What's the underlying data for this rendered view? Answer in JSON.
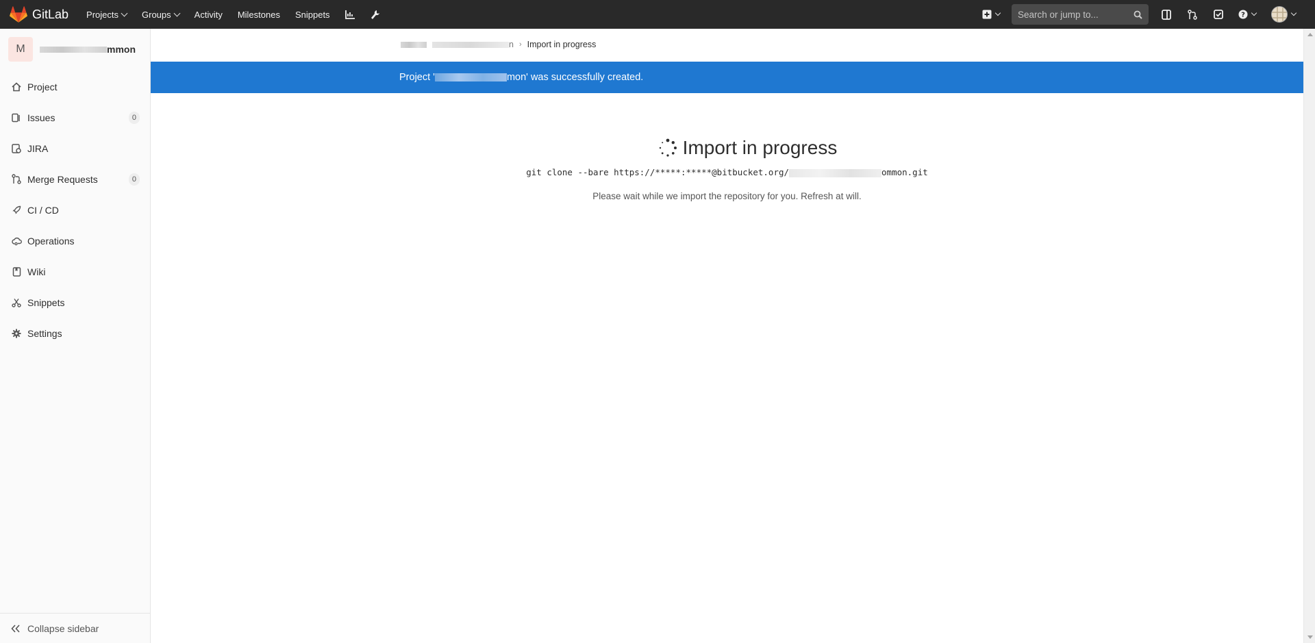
{
  "navbar": {
    "brand": "GitLab",
    "links": [
      "Projects",
      "Groups",
      "Activity",
      "Milestones",
      "Snippets"
    ],
    "search_placeholder": "Search or jump to...",
    "icons": [
      "chart-icon",
      "wrench-icon",
      "plus-square-icon",
      "sidebar-panel-icon",
      "merge-request-icon",
      "todo-check-icon",
      "help-icon",
      "user-avatar"
    ]
  },
  "sidebar": {
    "context_initial": "M",
    "context_name_suffix": "mmon",
    "items": [
      {
        "label": "Project",
        "icon": "home-icon"
      },
      {
        "label": "Issues",
        "icon": "issues-icon",
        "count": "0"
      },
      {
        "label": "JIRA",
        "icon": "jira-icon"
      },
      {
        "label": "Merge Requests",
        "icon": "merge-request-icon",
        "count": "0"
      },
      {
        "label": "CI / CD",
        "icon": "rocket-icon"
      },
      {
        "label": "Operations",
        "icon": "cloud-gear-icon"
      },
      {
        "label": "Wiki",
        "icon": "book-icon"
      },
      {
        "label": "Snippets",
        "icon": "scissors-icon"
      },
      {
        "label": "Settings",
        "icon": "gear-icon"
      }
    ],
    "collapse_label": "Collapse sidebar"
  },
  "breadcrumb": {
    "parent_suffix": "n",
    "current": "Import in progress"
  },
  "flash": {
    "prefix": "Project '",
    "suffix": "mon' was successfully created."
  },
  "main": {
    "title": "Import in progress",
    "cmd_prefix": "git clone --bare https://*****:*****@bitbucket.org/",
    "cmd_suffix": "ommon.git",
    "wait_text": "Please wait while we import the repository for you. Refresh at will."
  },
  "colors": {
    "navbar_bg": "#292929",
    "flash_bg": "#1f78d1",
    "sidebar_bg": "#fafafa",
    "brand_orange": "#fc6d26"
  }
}
